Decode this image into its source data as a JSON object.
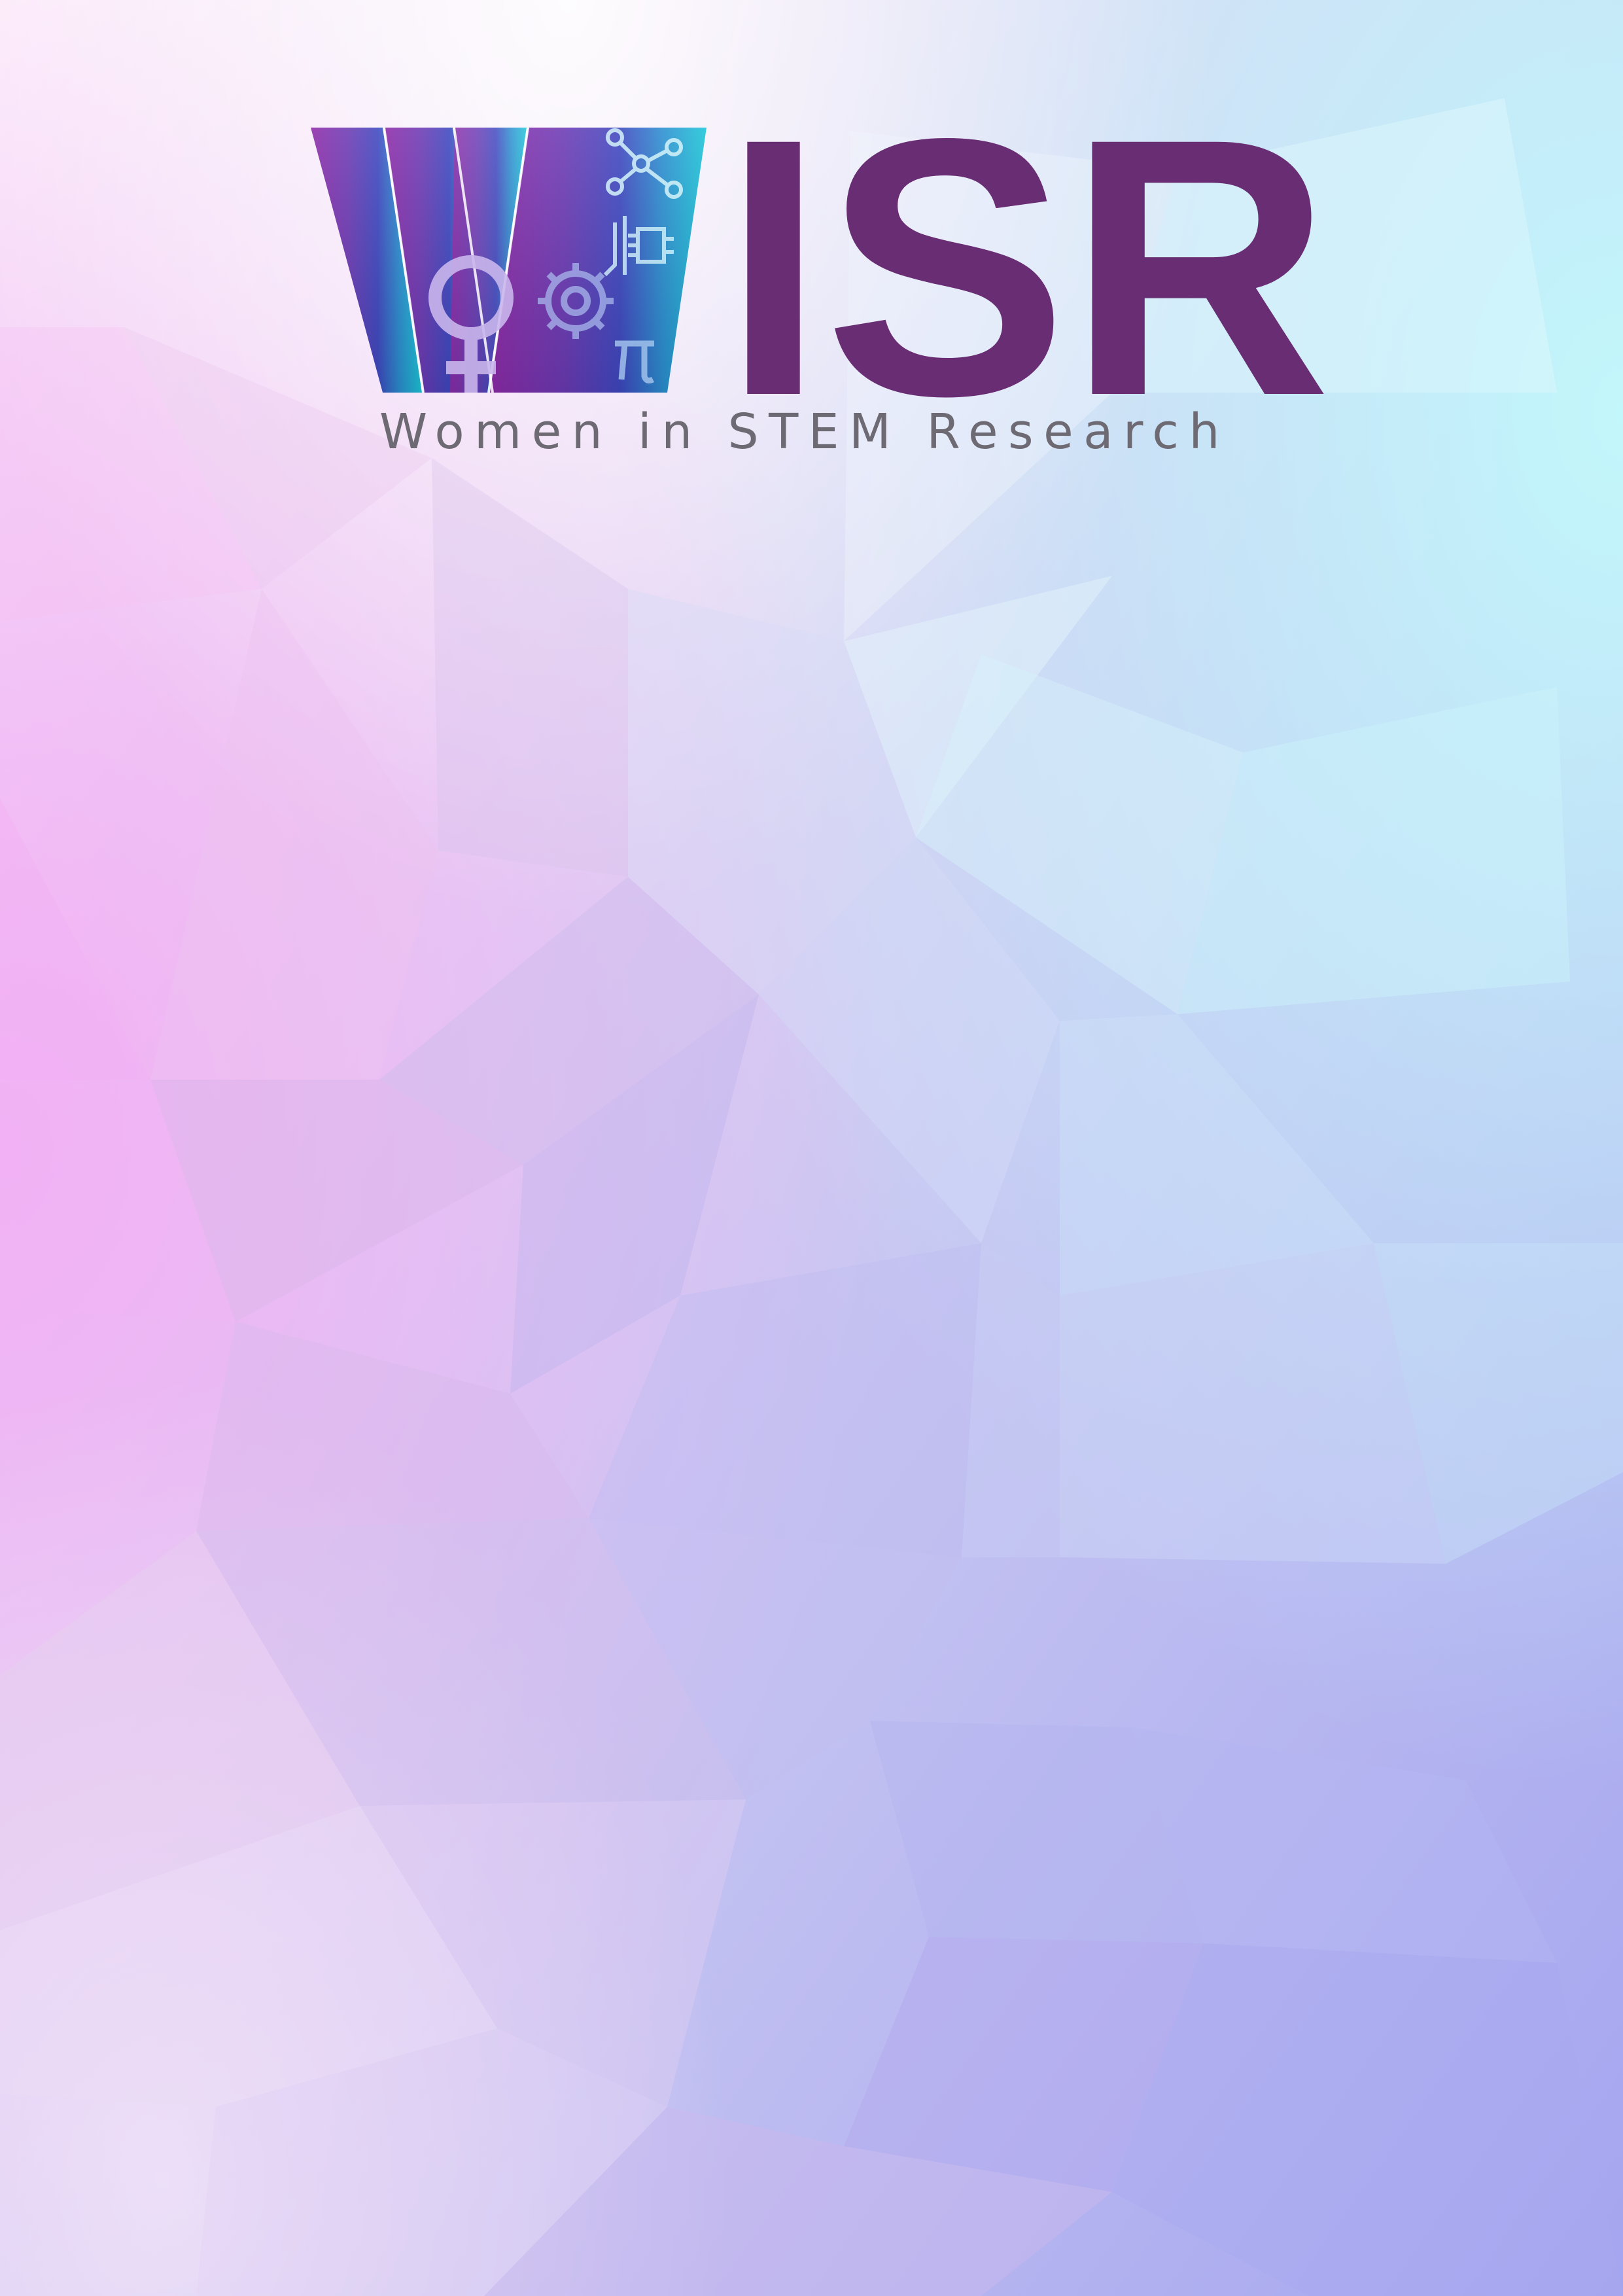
{
  "logo": {
    "wordmark_rest": "ISR",
    "tagline": "Women in STEM Research"
  },
  "colors": {
    "wordmark": "#692d73",
    "tagline": "#6e6a73",
    "w_left": "#8e2aa8",
    "w_mid": "#4d3fb3",
    "w_right": "#1bbfd6",
    "bg_top_left": "#fde9fb",
    "bg_pink": "#f2b2f2",
    "bg_cyan": "#c8f6fb",
    "bg_lavender": "#b8b8f0",
    "bg_bottom_right": "#a3a4ef"
  },
  "icons": [
    "female-symbol-icon",
    "gear-icon",
    "pi-icon",
    "circuit-icon",
    "network-nodes-icon"
  ]
}
